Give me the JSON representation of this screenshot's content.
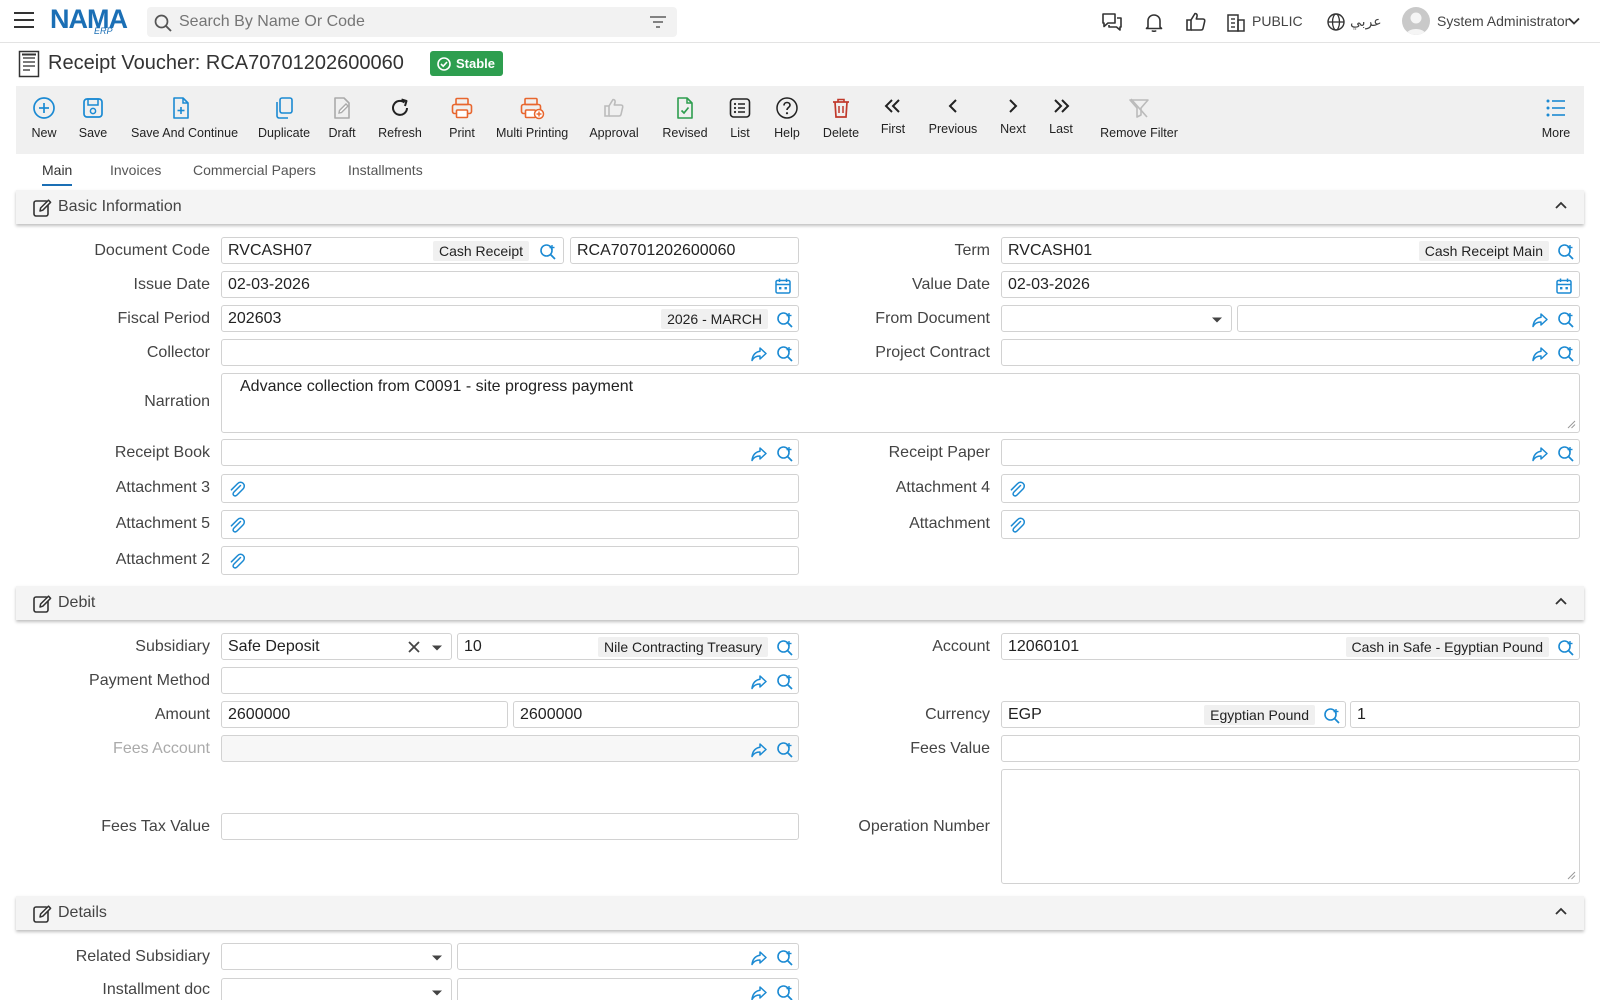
{
  "app": {
    "logo_text": "NAMA",
    "logo_sub": "ERP",
    "search_placeholder": "Search By Name Or Code",
    "public_label": "PUBLIC",
    "language_label": "عربي",
    "user_name": "System Administrator"
  },
  "page": {
    "title": "Receipt Voucher: RCA70701202600060",
    "status_badge": "Stable"
  },
  "toolbar": {
    "new": "New",
    "save": "Save",
    "save_continue": "Save And Continue",
    "duplicate": "Duplicate",
    "draft": "Draft",
    "refresh": "Refresh",
    "print": "Print",
    "multi_printing": "Multi Printing",
    "approval": "Approval",
    "revised": "Revised",
    "list": "List",
    "help": "Help",
    "delete": "Delete",
    "first": "First",
    "previous": "Previous",
    "next": "Next",
    "last": "Last",
    "remove_filter": "Remove Filter",
    "more": "More"
  },
  "tabs": [
    "Main",
    "Invoices",
    "Commercial Papers",
    "Installments"
  ],
  "sections": {
    "basic": "Basic Information",
    "debit": "Debit",
    "details": "Details"
  },
  "basic": {
    "document_code": {
      "label": "Document Code",
      "value": "RVCASH07",
      "tag": "Cash Receipt",
      "code": "RCA70701202600060"
    },
    "term": {
      "label": "Term",
      "value": "RVCASH01",
      "tag": "Cash Receipt Main"
    },
    "issue_date": {
      "label": "Issue Date",
      "value": "02-03-2026"
    },
    "value_date": {
      "label": "Value Date",
      "value": "02-03-2026"
    },
    "fiscal_period": {
      "label": "Fiscal Period",
      "value": "202603",
      "tag": "2026 - MARCH"
    },
    "from_document": {
      "label": "From Document"
    },
    "collector": {
      "label": "Collector"
    },
    "project_contract": {
      "label": "Project Contract"
    },
    "narration": {
      "label": "Narration",
      "value": "Advance collection from C0091 - site progress payment"
    },
    "receipt_book": {
      "label": "Receipt Book"
    },
    "receipt_paper": {
      "label": "Receipt Paper"
    },
    "attachment3": {
      "label": "Attachment 3"
    },
    "attachment4": {
      "label": "Attachment 4"
    },
    "attachment5": {
      "label": "Attachment 5"
    },
    "attachment": {
      "label": "Attachment"
    },
    "attachment2": {
      "label": "Attachment 2"
    }
  },
  "debit": {
    "subsidiary": {
      "label": "Subsidiary",
      "value": "Safe Deposit",
      "code": "10",
      "tag": "Nile Contracting Treasury"
    },
    "account": {
      "label": "Account",
      "value": "12060101",
      "tag": "Cash in Safe - Egyptian Pound"
    },
    "payment_method": {
      "label": "Payment Method"
    },
    "amount": {
      "label": "Amount",
      "value": "2600000",
      "value2": "2600000"
    },
    "currency": {
      "label": "Currency",
      "value": "EGP",
      "tag": "Egyptian Pound",
      "rate": "1"
    },
    "fees_account": {
      "label": "Fees Account"
    },
    "fees_value": {
      "label": "Fees Value"
    },
    "fees_tax_value": {
      "label": "Fees Tax Value"
    },
    "operation_number": {
      "label": "Operation Number"
    }
  },
  "details": {
    "related_subsidiary": {
      "label": "Related Subsidiary"
    },
    "installment_doc": {
      "label": "Installment doc"
    }
  },
  "colors": {
    "brand": "#1b6fb5",
    "stable": "#2e9e4f",
    "print_orange": "#e8662e",
    "delete_red": "#c0392b",
    "revised_green": "#2e9e4f",
    "link_blue": "#1b8ad3"
  }
}
